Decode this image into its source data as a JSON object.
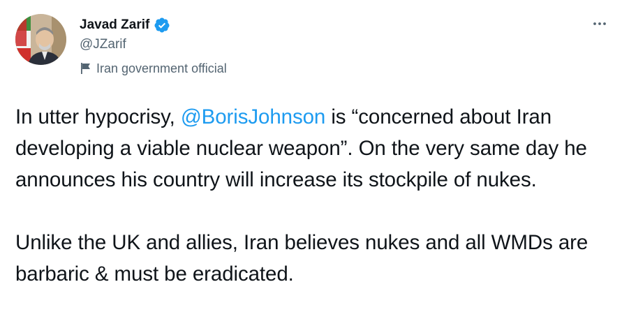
{
  "author": {
    "display_name": "Javad Zarif",
    "handle": "@JZarif",
    "label": "Iran government official"
  },
  "colors": {
    "text": "#0f1419",
    "secondary": "#536471",
    "accent": "#1d9bf0"
  },
  "icons": {
    "verified": "verified-badge-icon",
    "label": "flag-icon",
    "more": "more-dots-icon"
  },
  "tweet": {
    "p1_before": "In utter hypocrisy, ",
    "mention": "@BorisJohnson",
    "p1_after": " is “concerned about Iran developing a viable nuclear weapon”. On the very same day he announces his country will increase its stockpile of nukes.",
    "p2": "Unlike the UK and allies, Iran believes nukes and all WMDs are barbaric & must be eradicated."
  }
}
